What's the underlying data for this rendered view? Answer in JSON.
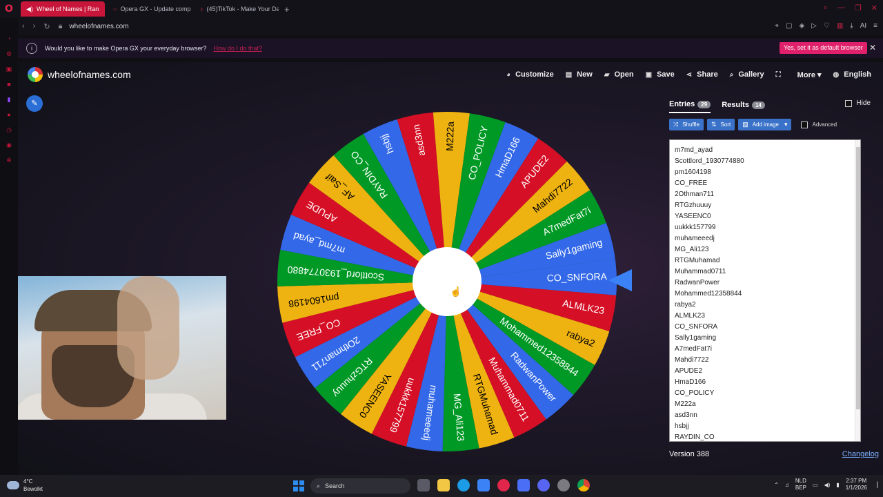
{
  "browser": {
    "tabs": [
      {
        "label": "Wheel of Names | Ran",
        "icon": "sound-icon",
        "active": true
      },
      {
        "label": "Opera GX - Update comp",
        "icon": "opera-icon",
        "active": false
      },
      {
        "label": "(45)TikTok - Make Your Da",
        "icon": "tiktok-icon",
        "active": false
      }
    ],
    "url": "wheelofnames.com",
    "notice": {
      "message": "Would you like to make Opera GX your everyday browser?",
      "how": "How do I do that?",
      "button": "Yes, set it as default browser"
    },
    "accent": "#e0264a"
  },
  "site": {
    "title": "wheelofnames.com",
    "menu": [
      {
        "label": "Customize",
        "icon": "palette-icon"
      },
      {
        "label": "New",
        "icon": "file-icon"
      },
      {
        "label": "Open",
        "icon": "folder-icon"
      },
      {
        "label": "Save",
        "icon": "save-icon"
      },
      {
        "label": "Share",
        "icon": "share-icon"
      },
      {
        "label": "Gallery",
        "icon": "search-icon"
      },
      {
        "label": "",
        "icon": "fullscreen-icon"
      },
      {
        "label": "More ▾",
        "icon": ""
      },
      {
        "label": "English",
        "icon": "globe-icon"
      }
    ]
  },
  "wheel": {
    "colors": [
      "#3369e8",
      "#d50f25",
      "#eeb211",
      "#009925"
    ],
    "segments": [
      "CO_SNFORA",
      "ALMLK23",
      "rabya2",
      "Mohammed12358844",
      "RadwanPower",
      "Muhammad0711",
      "RTGMuhamad",
      "MG_Ali123",
      "muhameeedj",
      "uukkk157799",
      "YASEENC0",
      "RTGzhuuuy",
      "2Othman711",
      "CO_FREE",
      "pm1604198",
      "Scottlord_1930774880",
      "m7md_ayad",
      "APUDE",
      "AF_Saif",
      "RAYDIN_CO",
      "hsbjj",
      "asd3nn",
      "M222a",
      "CO_POLICY",
      "HmaD166",
      "APUDE2",
      "Mahdi7722",
      "A7medFat7i",
      "Sally1gaming"
    ]
  },
  "panel": {
    "tabs": [
      {
        "label": "Entries",
        "count": "29"
      },
      {
        "label": "Results",
        "count": "14"
      }
    ],
    "hide": "Hide",
    "buttons": [
      "Shuffle",
      "Sort",
      "Add image"
    ],
    "advanced": "Advanced",
    "entries": [
      "m7md_ayad",
      "Scottlord_1930774880",
      "pm1604198",
      "CO_FREE",
      "2Othman711",
      "RTGzhuuuy",
      "YASEENC0",
      "uukkk157799",
      "muhameeedj",
      "MG_Ali123",
      "RTGMuhamad",
      "Muhammad0711",
      "RadwanPower",
      "Mohammed12358844",
      "rabya2",
      "ALMLK23",
      "CO_SNFORA",
      "Sally1gaming",
      "A7medFat7i",
      "Mahdi7722",
      "APUDE2",
      "HmaD166",
      "CO_POLICY",
      "M222a",
      "asd3nn",
      "hsbjj",
      "RAYDIN_CO"
    ],
    "version": "Version 388",
    "changelog": "Changelog"
  },
  "taskbar": {
    "temp": "4°C",
    "weather": "Bewolkt",
    "search": "Search",
    "lang": "NLD",
    "lang2": "BEP",
    "time": "2:37 PM",
    "date": "1/1/2026"
  }
}
